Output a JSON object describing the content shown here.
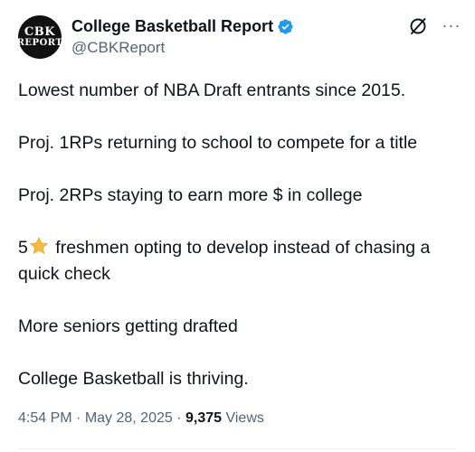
{
  "author": {
    "avatar_text_line1": "CBK",
    "avatar_text_line2": "REPORT",
    "display_name": "College Basketball Report",
    "handle": "@CBKReport",
    "verified_color": "#1d9bf0"
  },
  "header_icons": {
    "grok": "grok-icon",
    "more": "more-options-icon",
    "more_glyph": "···"
  },
  "tweet": {
    "paragraphs": [
      "Lowest number of NBA Draft entrants since 2015.",
      "Proj. 1RPs returning to school to compete for a title",
      "Proj. 2RPs staying to earn more $ in college",
      "More seniors getting drafted",
      "College Basketball is thriving."
    ],
    "star_paragraph": {
      "before": "5",
      "emoji": "star-emoji",
      "after": " freshmen opting to develop instead of chasing a quick check"
    }
  },
  "meta": {
    "time": "4:54 PM",
    "separator": " · ",
    "date": "May 28, 2025",
    "views_count": "9,375",
    "views_label": " Views"
  },
  "colors": {
    "text": "#0f1419",
    "secondary": "#536471",
    "verified": "#1d9bf0",
    "star": "#f6b93b"
  }
}
